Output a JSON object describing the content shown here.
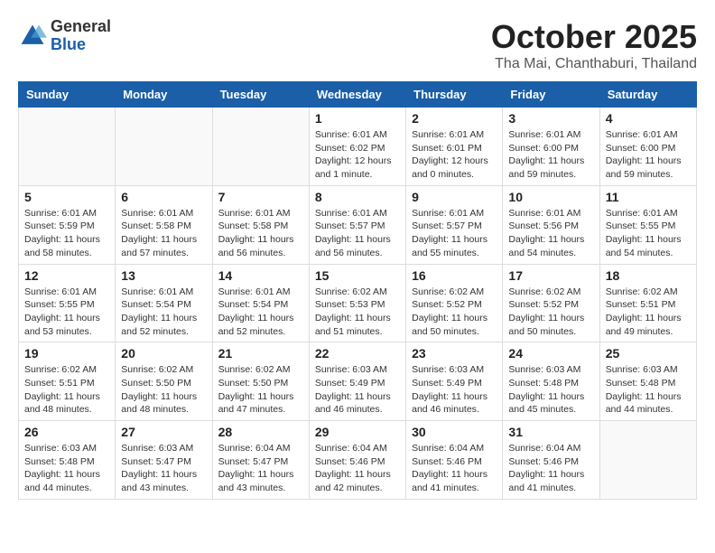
{
  "logo": {
    "general": "General",
    "blue": "Blue"
  },
  "header": {
    "month": "October 2025",
    "location": "Tha Mai, Chanthaburi, Thailand"
  },
  "weekdays": [
    "Sunday",
    "Monday",
    "Tuesday",
    "Wednesday",
    "Thursday",
    "Friday",
    "Saturday"
  ],
  "weeks": [
    [
      {
        "day": "",
        "info": ""
      },
      {
        "day": "",
        "info": ""
      },
      {
        "day": "",
        "info": ""
      },
      {
        "day": "1",
        "info": "Sunrise: 6:01 AM\nSunset: 6:02 PM\nDaylight: 12 hours\nand 1 minute."
      },
      {
        "day": "2",
        "info": "Sunrise: 6:01 AM\nSunset: 6:01 PM\nDaylight: 12 hours\nand 0 minutes."
      },
      {
        "day": "3",
        "info": "Sunrise: 6:01 AM\nSunset: 6:00 PM\nDaylight: 11 hours\nand 59 minutes."
      },
      {
        "day": "4",
        "info": "Sunrise: 6:01 AM\nSunset: 6:00 PM\nDaylight: 11 hours\nand 59 minutes."
      }
    ],
    [
      {
        "day": "5",
        "info": "Sunrise: 6:01 AM\nSunset: 5:59 PM\nDaylight: 11 hours\nand 58 minutes."
      },
      {
        "day": "6",
        "info": "Sunrise: 6:01 AM\nSunset: 5:58 PM\nDaylight: 11 hours\nand 57 minutes."
      },
      {
        "day": "7",
        "info": "Sunrise: 6:01 AM\nSunset: 5:58 PM\nDaylight: 11 hours\nand 56 minutes."
      },
      {
        "day": "8",
        "info": "Sunrise: 6:01 AM\nSunset: 5:57 PM\nDaylight: 11 hours\nand 56 minutes."
      },
      {
        "day": "9",
        "info": "Sunrise: 6:01 AM\nSunset: 5:57 PM\nDaylight: 11 hours\nand 55 minutes."
      },
      {
        "day": "10",
        "info": "Sunrise: 6:01 AM\nSunset: 5:56 PM\nDaylight: 11 hours\nand 54 minutes."
      },
      {
        "day": "11",
        "info": "Sunrise: 6:01 AM\nSunset: 5:55 PM\nDaylight: 11 hours\nand 54 minutes."
      }
    ],
    [
      {
        "day": "12",
        "info": "Sunrise: 6:01 AM\nSunset: 5:55 PM\nDaylight: 11 hours\nand 53 minutes."
      },
      {
        "day": "13",
        "info": "Sunrise: 6:01 AM\nSunset: 5:54 PM\nDaylight: 11 hours\nand 52 minutes."
      },
      {
        "day": "14",
        "info": "Sunrise: 6:01 AM\nSunset: 5:54 PM\nDaylight: 11 hours\nand 52 minutes."
      },
      {
        "day": "15",
        "info": "Sunrise: 6:02 AM\nSunset: 5:53 PM\nDaylight: 11 hours\nand 51 minutes."
      },
      {
        "day": "16",
        "info": "Sunrise: 6:02 AM\nSunset: 5:52 PM\nDaylight: 11 hours\nand 50 minutes."
      },
      {
        "day": "17",
        "info": "Sunrise: 6:02 AM\nSunset: 5:52 PM\nDaylight: 11 hours\nand 50 minutes."
      },
      {
        "day": "18",
        "info": "Sunrise: 6:02 AM\nSunset: 5:51 PM\nDaylight: 11 hours\nand 49 minutes."
      }
    ],
    [
      {
        "day": "19",
        "info": "Sunrise: 6:02 AM\nSunset: 5:51 PM\nDaylight: 11 hours\nand 48 minutes."
      },
      {
        "day": "20",
        "info": "Sunrise: 6:02 AM\nSunset: 5:50 PM\nDaylight: 11 hours\nand 48 minutes."
      },
      {
        "day": "21",
        "info": "Sunrise: 6:02 AM\nSunset: 5:50 PM\nDaylight: 11 hours\nand 47 minutes."
      },
      {
        "day": "22",
        "info": "Sunrise: 6:03 AM\nSunset: 5:49 PM\nDaylight: 11 hours\nand 46 minutes."
      },
      {
        "day": "23",
        "info": "Sunrise: 6:03 AM\nSunset: 5:49 PM\nDaylight: 11 hours\nand 46 minutes."
      },
      {
        "day": "24",
        "info": "Sunrise: 6:03 AM\nSunset: 5:48 PM\nDaylight: 11 hours\nand 45 minutes."
      },
      {
        "day": "25",
        "info": "Sunrise: 6:03 AM\nSunset: 5:48 PM\nDaylight: 11 hours\nand 44 minutes."
      }
    ],
    [
      {
        "day": "26",
        "info": "Sunrise: 6:03 AM\nSunset: 5:48 PM\nDaylight: 11 hours\nand 44 minutes."
      },
      {
        "day": "27",
        "info": "Sunrise: 6:03 AM\nSunset: 5:47 PM\nDaylight: 11 hours\nand 43 minutes."
      },
      {
        "day": "28",
        "info": "Sunrise: 6:04 AM\nSunset: 5:47 PM\nDaylight: 11 hours\nand 43 minutes."
      },
      {
        "day": "29",
        "info": "Sunrise: 6:04 AM\nSunset: 5:46 PM\nDaylight: 11 hours\nand 42 minutes."
      },
      {
        "day": "30",
        "info": "Sunrise: 6:04 AM\nSunset: 5:46 PM\nDaylight: 11 hours\nand 41 minutes."
      },
      {
        "day": "31",
        "info": "Sunrise: 6:04 AM\nSunset: 5:46 PM\nDaylight: 11 hours\nand 41 minutes."
      },
      {
        "day": "",
        "info": ""
      }
    ]
  ]
}
